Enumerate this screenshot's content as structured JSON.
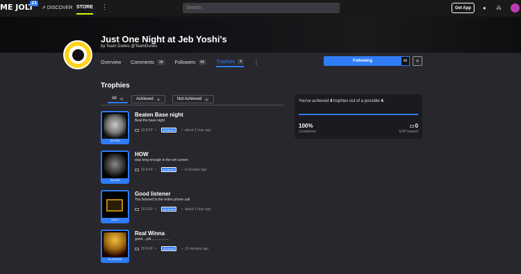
{
  "topbar": {
    "logo_text": "ME JOLT",
    "logo_badge": "21",
    "discover": "DISCOVER",
    "store": "STORE",
    "search_placeholder": "Search",
    "get_app": "Get App"
  },
  "game": {
    "title": "Just One Night at Jeb Yoshi's",
    "byline": "by Team Dunes @TeamDunes"
  },
  "tabs": [
    {
      "label": "Overview",
      "count": ""
    },
    {
      "label": "Comments",
      "count": "18"
    },
    {
      "label": "Followers",
      "count": "66"
    },
    {
      "label": "Trophies",
      "count": "4"
    }
  ],
  "follow": {
    "label": "Following",
    "count": "66"
  },
  "section_title": "Trophies",
  "filters": [
    {
      "label": "All",
      "count": "4"
    },
    {
      "label": "Achieved",
      "count": "4"
    },
    {
      "label": "Not Achieved",
      "count": "0"
    }
  ],
  "trophies": [
    {
      "name": "Beaten Base night",
      "desc": "Beat the base night",
      "exp": "10 EXP",
      "status": "Achieved",
      "time": "about 1 hour ago",
      "level": "SILVER",
      "art_color": "#888a8c"
    },
    {
      "name": "HOW",
      "desc": "stay long enough in the win screen",
      "exp": "10 EXP",
      "status": "Achieved",
      "time": "4 minutes ago",
      "level": "SILVER",
      "art_color": "#5a5a5c"
    },
    {
      "name": "Good listener",
      "desc": "You listened to the entire phone call",
      "exp": "15 EXP",
      "status": "Achieved",
      "time": "about 1 hour ago",
      "level": "GOLD",
      "art_color": "#8a6a10"
    },
    {
      "name": "Real Winna",
      "desc": "good....job...................",
      "exp": "20 EXP",
      "status": "Achieved",
      "time": "15 minutes ago",
      "level": "PLATINUM",
      "art_color": "#b88a1a"
    }
  ],
  "summary": {
    "prefix": "You've achieved",
    "achieved": "4",
    "middle": "trophies out of a possible",
    "total": "4",
    "suffix": ".",
    "completion_value": "100%",
    "completion_label": "Completion",
    "exp_value": "0",
    "exp_label": "EXP Gained"
  },
  "colors": {
    "accent": "#2f7cf6",
    "store_underline": "#ccff00"
  }
}
